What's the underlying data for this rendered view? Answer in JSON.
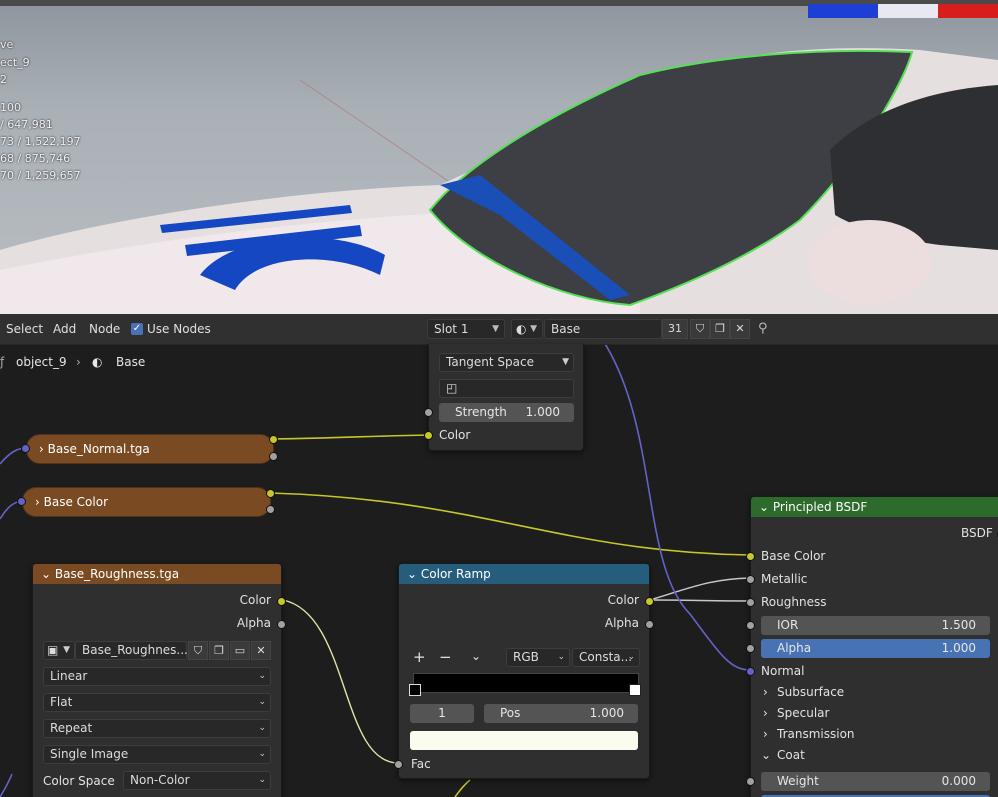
{
  "viewport": {
    "stats": [
      "ve",
      "ect_9",
      "2",
      "100",
      "/ 647,981",
      "73 / 1,522,197",
      "68 / 875,746",
      "70 / 1,259,657"
    ]
  },
  "header": {
    "menu": [
      "Select",
      "Add",
      "Node"
    ],
    "use_nodes_label": "Use Nodes",
    "slot": "Slot 1",
    "material_name": "Base",
    "user_count": "31"
  },
  "breadcrumb": {
    "object": "object_9",
    "material": "Base"
  },
  "normal_map_node": {
    "space": "Tangent Space",
    "strength_label": "Strength",
    "strength_value": "1.000",
    "input_color": "Color"
  },
  "collapsed_nodes": {
    "normal_tex": "Base_Normal.tga",
    "base_color": "Base Color"
  },
  "roughness_node": {
    "title": "Base_Roughness.tga",
    "out_color": "Color",
    "out_alpha": "Alpha",
    "image_name": "Base_Roughnes...",
    "interpolation": "Linear",
    "projection": "Flat",
    "extension": "Repeat",
    "source": "Single Image",
    "color_space_label": "Color Space",
    "color_space": "Non-Color"
  },
  "color_ramp_node": {
    "title": "Color Ramp",
    "out_color": "Color",
    "out_alpha": "Alpha",
    "mode": "RGB",
    "interp": "Consta...",
    "index": "1",
    "pos_label": "Pos",
    "pos_value": "1.000",
    "in_fac": "Fac"
  },
  "bsdf_node": {
    "title": "Principled BSDF",
    "out_bsdf": "BSDF",
    "base_color": "Base Color",
    "metallic": "Metallic",
    "roughness": "Roughness",
    "ior_label": "IOR",
    "ior_value": "1.500",
    "alpha_label": "Alpha",
    "alpha_value": "1.000",
    "normal": "Normal",
    "subsurface": "Subsurface",
    "specular": "Specular",
    "transmission": "Transmission",
    "coat": "Coat",
    "weight_label": "Weight",
    "weight_value": "0.000"
  },
  "colors": {
    "image_node_header": "#7a4b22",
    "color_ramp_header": "#265c7c",
    "bsdf_header": "#2c6b2c",
    "alpha_field": "#4772b3",
    "socket_color": "#c7c729",
    "socket_float": "#a1a1a1",
    "socket_vector": "#6363c7"
  }
}
